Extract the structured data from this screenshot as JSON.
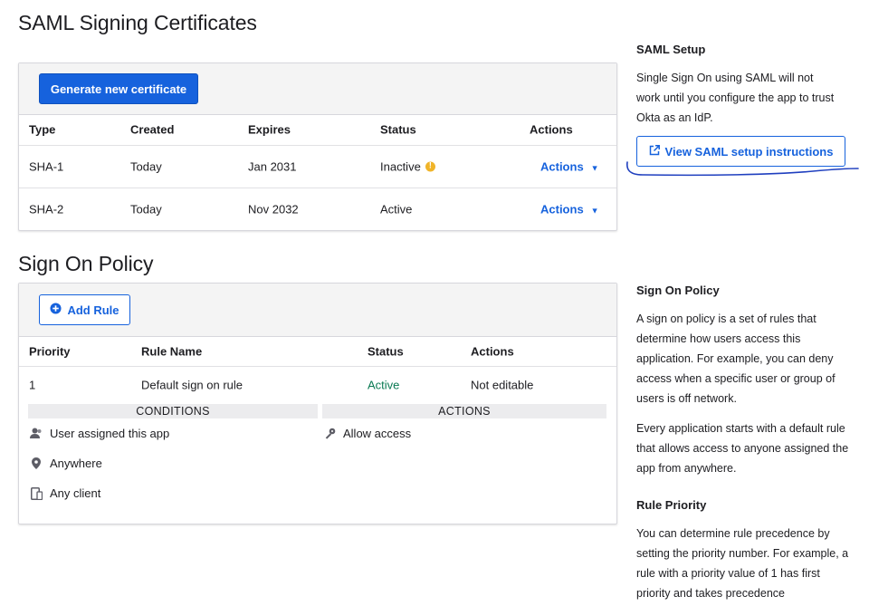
{
  "saml_certs": {
    "title": "SAML Signing Certificates",
    "generate_label": "Generate new certificate",
    "columns": [
      "Type",
      "Created",
      "Expires",
      "Status",
      "Actions"
    ],
    "rows": [
      {
        "type": "SHA-1",
        "created": "Today",
        "expires": "Jan 2031",
        "status": "Inactive",
        "status_warning": true,
        "action": "Actions"
      },
      {
        "type": "SHA-2",
        "created": "Today",
        "expires": "Nov 2032",
        "status": "Active",
        "status_warning": false,
        "action": "Actions"
      }
    ]
  },
  "policy": {
    "title": "Sign On Policy",
    "add_rule_label": "Add Rule",
    "columns": [
      "Priority",
      "Rule Name",
      "Status",
      "Actions"
    ],
    "rule": {
      "priority": "1",
      "name": "Default sign on rule",
      "status": "Active",
      "actions": "Not editable"
    },
    "conditions_label": "CONDITIONS",
    "actions_label": "ACTIONS",
    "conditions": [
      {
        "icon": "user-icon",
        "text": "User assigned this app"
      },
      {
        "icon": "location-pin-icon",
        "text": "Anywhere"
      },
      {
        "icon": "device-icon",
        "text": "Any client"
      }
    ],
    "actions": [
      {
        "icon": "key-icon",
        "text": "Allow access"
      }
    ]
  },
  "sidebar": {
    "saml_setup_title": "SAML Setup",
    "saml_setup_text": "Single Sign On using SAML will not work until you configure the app to trust Okta as an IdP.",
    "view_instructions_label": "View SAML setup instructions",
    "policy_title": "Sign On Policy",
    "policy_text_1": "A sign on policy is a set of rules that determine how users access this application. For example, you can deny access when a specific user or group of users is off network.",
    "policy_text_2": "Every application starts with a default rule that allows access to anyone assigned the app from anywhere.",
    "priority_title": "Rule Priority",
    "priority_text": "You can determine rule precedence by setting the priority number. For example, a rule with a priority value of 1 has first priority and takes precedence"
  },
  "colors": {
    "primary": "#1662dd",
    "active": "#0b7a53",
    "warning": "#f0b429",
    "annotation": "#1f3fbf"
  }
}
